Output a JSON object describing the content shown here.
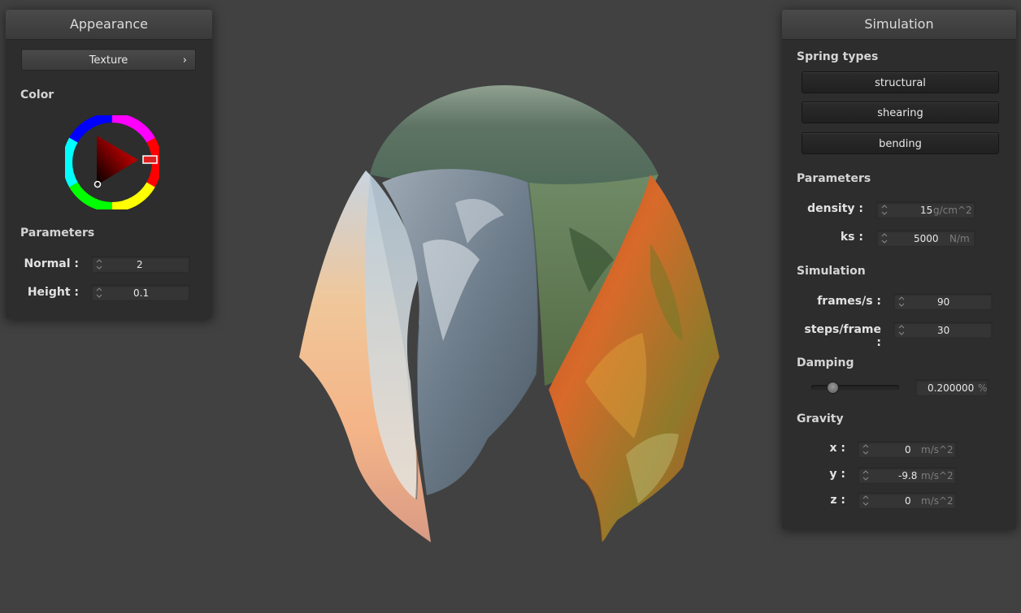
{
  "appearance": {
    "title": "Appearance",
    "texture_button": "Texture",
    "texture_chevron": "›",
    "color_section": "Color",
    "parameters_section": "Parameters",
    "normal": {
      "label": "Normal :",
      "value": "2"
    },
    "height": {
      "label": "Height :",
      "value": "0.1"
    },
    "selected_color": "#ff0000"
  },
  "simulation": {
    "title": "Simulation",
    "spring_types_section": "Spring types",
    "spring_buttons": [
      "structural",
      "shearing",
      "bending"
    ],
    "parameters_section": "Parameters",
    "density": {
      "label": "density :",
      "value": "15",
      "unit": "g/cm^2"
    },
    "ks": {
      "label": "ks :",
      "value": "5000",
      "unit": "N/m"
    },
    "simulation_section": "Simulation",
    "fps": {
      "label": "frames/s :",
      "value": "90"
    },
    "steps": {
      "label": "steps/frame :",
      "value": "30"
    },
    "damping_section": "Damping",
    "damping": {
      "value": "0.200000",
      "unit": "%",
      "slider_fraction": 0.2
    },
    "gravity_section": "Gravity",
    "gravity_x": {
      "label": "x :",
      "value": "0",
      "unit": "m/s^2"
    },
    "gravity_y": {
      "label": "y :",
      "value": "-9.8",
      "unit": "m/s^2"
    },
    "gravity_z": {
      "label": "z :",
      "value": "0",
      "unit": "m/s^2"
    }
  },
  "viewport": {
    "background": "#414141",
    "object": "textured-cloth-draped-over-sphere"
  }
}
